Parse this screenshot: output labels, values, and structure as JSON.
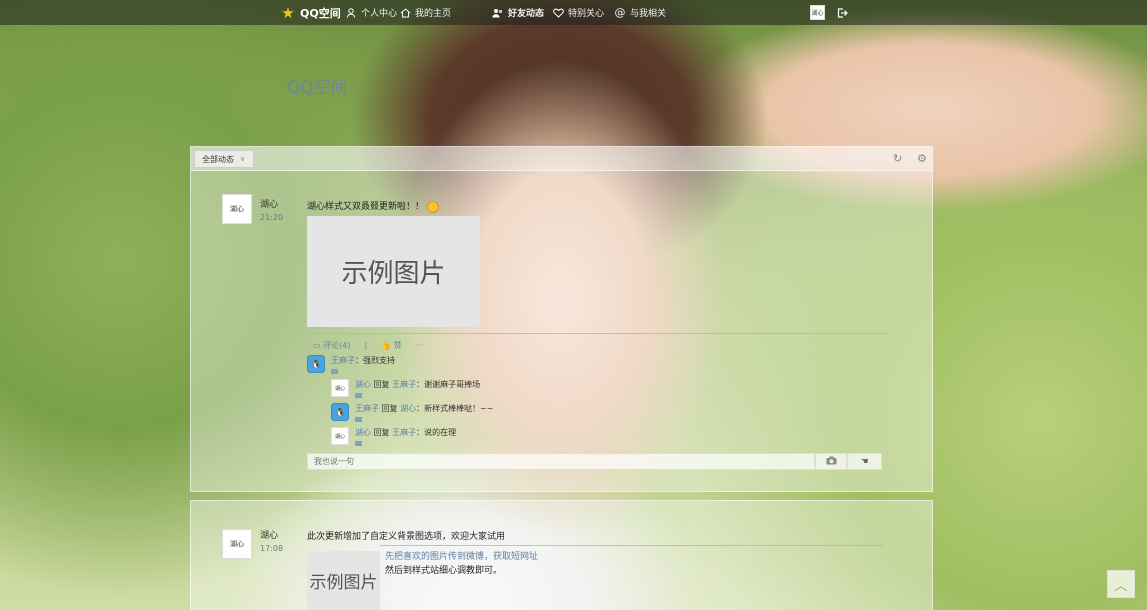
{
  "nav": {
    "logo": "QQ空间",
    "items": [
      {
        "label": "个人中心",
        "icon": "person-icon"
      },
      {
        "label": "我的主页",
        "icon": "home-icon"
      },
      {
        "label": "好友动态",
        "icon": "friends-icon"
      },
      {
        "label": "特别关心",
        "icon": "heart-icon"
      },
      {
        "label": "与我相关",
        "icon": "at-icon"
      }
    ],
    "user_avatar": "湖心",
    "logout_icon": "logout-icon"
  },
  "page_title": "QQ空间",
  "feed": {
    "filter_label": "全部动态",
    "posts": [
      {
        "author": "湖心",
        "time": "21:20",
        "text": "湖心样式又双叒叕更新啦！！",
        "image_label": "示例图片",
        "actions": [
          "评论(4)",
          "|",
          "赞",
          "···"
        ],
        "comments": [
          {
            "name": "王麻子",
            "text": "强烈支持"
          },
          {
            "name": "湖心",
            "verb": "回复",
            "target": "王麻子",
            "text": "谢谢麻子哥捧场"
          },
          {
            "name": "王麻子",
            "verb": "回复",
            "target": "湖心",
            "text": "新样式棒棒哒！~~"
          },
          {
            "name": "湖心",
            "verb": "回复",
            "target": "王麻子",
            "text": "说的在理"
          }
        ],
        "reply_placeholder": "我也说一句"
      },
      {
        "author": "湖心",
        "time": "17:08",
        "text": "此次更新增加了自定义背景图选项，欢迎大家试用",
        "image_label": "示例图片",
        "link_text": "先把喜欢的图片传到微博，获取短网址",
        "extra_text": "然后到样式站细心调教即可。"
      }
    ]
  },
  "colors": {
    "nav_bg": "#1e1e1e",
    "link": "#5e7ea8",
    "title": "#6a84a5"
  }
}
